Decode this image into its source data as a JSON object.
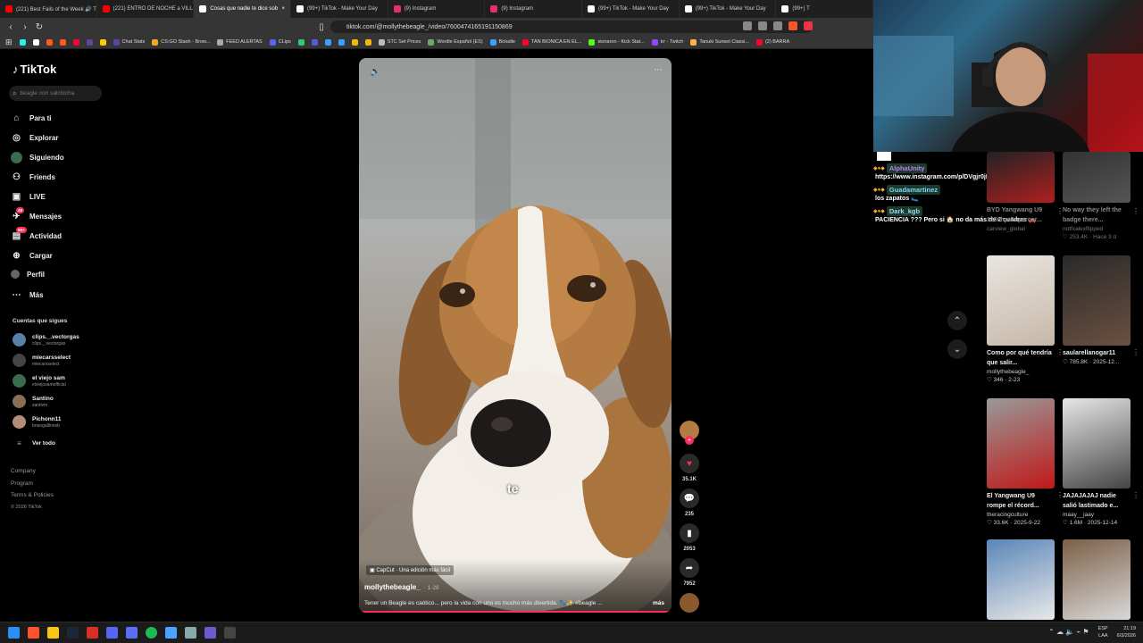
{
  "browser": {
    "tabs": [
      {
        "label": "(221) Best Fails of the Week 🔊 T",
        "color": "#ff0000"
      },
      {
        "label": "(221) ENTRO DE NOCHE a VILLA",
        "color": "#ff0000"
      },
      {
        "label": "Cosas que nadie te dice sob",
        "color": "#ffffff"
      },
      {
        "label": "(99+) TikTok - Make Your Day",
        "color": "#ffffff"
      },
      {
        "label": "(9) Instagram",
        "color": "#e1306c"
      },
      {
        "label": "(9) Instagram",
        "color": "#e1306c"
      },
      {
        "label": "(99+) TikTok - Make Your Day",
        "color": "#ffffff"
      },
      {
        "label": "(99+) TikTok - Make Your Day",
        "color": "#ffffff"
      },
      {
        "label": "(99+) T",
        "color": "#ffffff"
      }
    ],
    "active_tab": 2,
    "url": "tiktok.com/@mollythebeagle_/video/7600474165191150869",
    "bookmarks": [
      {
        "label": "",
        "color": "#25f4ee"
      },
      {
        "label": "",
        "color": "#ffffff"
      },
      {
        "label": "",
        "color": "#ff5722"
      },
      {
        "label": "",
        "color": "#ff5722"
      },
      {
        "label": "",
        "color": "#ff0033"
      },
      {
        "label": "",
        "color": "#6441a5"
      },
      {
        "label": "",
        "color": "#ffcc00"
      },
      {
        "label": "Chat Stats",
        "color": "#6441a5"
      },
      {
        "label": "CS:GO Stash - Brow...",
        "color": "#f5a623"
      },
      {
        "label": "FEED ALERTAS",
        "color": "#aaaaaa"
      },
      {
        "label": "CLips",
        "color": "#5865f2"
      },
      {
        "label": "",
        "color": "#2ecc71"
      },
      {
        "label": "",
        "color": "#5b5bd6"
      },
      {
        "label": "",
        "color": "#3aa0ff"
      },
      {
        "label": "",
        "color": "#3aa0ff"
      },
      {
        "label": "",
        "color": "#f0b90b"
      },
      {
        "label": "",
        "color": "#f0b90b"
      },
      {
        "label": "STC Set Prices",
        "color": "#bbbbbb"
      },
      {
        "label": "Wordle Español (ES)",
        "color": "#6aaa64"
      },
      {
        "label": "Boludle",
        "color": "#3aa0ff"
      },
      {
        "label": "TAN BIONICA EN EL...",
        "color": "#ff0033"
      },
      {
        "label": "sionaron - Kick Stat...",
        "color": "#53fc18"
      },
      {
        "label": "trr - Twitch",
        "color": "#9146ff"
      },
      {
        "label": "Tanuki Sunset Classi...",
        "color": "#ffb347"
      },
      {
        "label": "(2) BARRA",
        "color": "#ff0033"
      }
    ]
  },
  "tiktok": {
    "logo": "TikTok",
    "search_placeholder": "beagle con salchicha",
    "nav": [
      {
        "label": "Para ti",
        "icon": "home-icon",
        "glyph": "⌂"
      },
      {
        "label": "Explorar",
        "icon": "compass-icon",
        "glyph": "◎"
      },
      {
        "label": "Siguiendo",
        "icon": "following-avatar-icon",
        "glyph": "●"
      },
      {
        "label": "Friends",
        "icon": "friends-icon",
        "glyph": "⚇"
      },
      {
        "label": "LIVE",
        "icon": "live-icon",
        "glyph": "▣"
      },
      {
        "label": "Mensajes",
        "icon": "messages-icon",
        "glyph": "✈",
        "badge": "48"
      },
      {
        "label": "Actividad",
        "icon": "activity-icon",
        "glyph": "▤",
        "badge": "99+"
      },
      {
        "label": "Cargar",
        "icon": "upload-icon",
        "glyph": "⊕"
      },
      {
        "label": "Perfil",
        "icon": "profile-icon",
        "glyph": "●"
      },
      {
        "label": "Más",
        "icon": "more-icon",
        "glyph": "⋯"
      }
    ],
    "following_header": "Cuentas que sigues",
    "following": [
      {
        "name": "clips._.vectorgas",
        "handle": "clips._.vectorgas",
        "color": "#5a7fa8"
      },
      {
        "name": "miecarsselect",
        "handle": "miecarsselect",
        "color": "#444444"
      },
      {
        "name": "el viejo sam",
        "handle": "elviejosamofficial",
        "color": "#3b6b4e"
      },
      {
        "name": "Santino",
        "handle": "zantivm",
        "color": "#8a6d55"
      },
      {
        "name": "Pichonn11",
        "handle": "briangallinosb",
        "color": "#b58e7a"
      }
    ],
    "see_all": "Ver todo",
    "footer": [
      "Company",
      "Program",
      "Terms & Policies",
      "© 2026 TikTok"
    ]
  },
  "video": {
    "capcut": "CapCut · Una edición más fácil",
    "username": "mollythebeagle_",
    "date": "· 1-28",
    "caption": "Tener un Beagle es caótico... pero la vida con uno es mucho más divertida. 🐾✨ #beagle ...",
    "more": "más",
    "overlay_text": "te",
    "progress": 1.0
  },
  "actions": {
    "likes": "35.1K",
    "comments": "235",
    "saves": "2053",
    "shares": "7952"
  },
  "chat": [
    {
      "user": "AlphaUnity",
      "user_color": "#c77dff",
      "message": "https://www.instagram.com/p/DVgjr0jISTe/"
    },
    {
      "user": "Guadamartinez",
      "user_color": "#7fd3ff",
      "message": "los zapatos 🥿"
    },
    {
      "user": "Dark_kgb",
      "user_color": "#9ad7ff",
      "message": "PACIENCIA ??? Pero si 🏠 no da más de 2 cuadras 🚗"
    }
  ],
  "recommended": [
    {
      "title": "BYD Yangwang U9 1300hp Supercar...",
      "user": "carview_global",
      "stats": "",
      "col": 0,
      "row": 0
    },
    {
      "title": "No way they left the badge there...",
      "user": "notfxalexflipped",
      "stats": "♡ 253.4K · Hace 3 d",
      "col": 1,
      "row": 0
    },
    {
      "title": "Como por qué tendría que salir...",
      "user": "mollythebeagle_",
      "stats": "♡ 346 · 2-23",
      "col": 0,
      "row": 1
    },
    {
      "title": "saularellanogar11",
      "user": "",
      "stats": "♡ 785.8K · 2025-12...",
      "col": 1,
      "row": 1
    },
    {
      "title": "El Yangwang U9 rompe el récord...",
      "user": "theracingculture",
      "stats": "♡ 33.6K · 2025-9-22",
      "col": 0,
      "row": 2
    },
    {
      "title": "JAJAJAJAJ nadie salió lastimado e...",
      "user": "maay__jaay",
      "stats": "♡ 1.6M · 2025-12-14",
      "col": 1,
      "row": 2
    }
  ],
  "taskbar": {
    "lang": "ESP",
    "lang2": "LAA",
    "time": "21:19",
    "date": "6/3/2026"
  }
}
